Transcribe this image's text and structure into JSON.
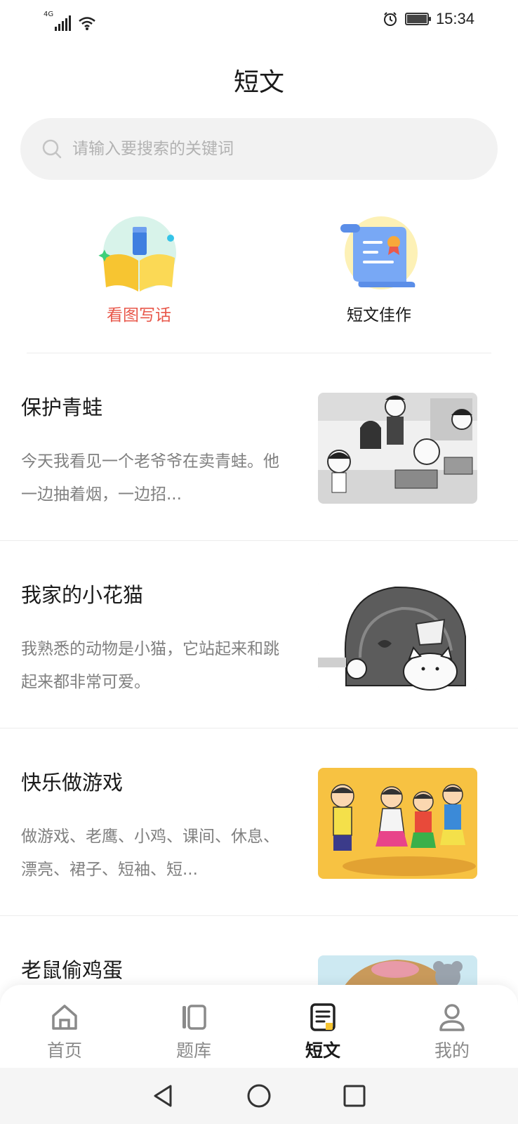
{
  "status_bar": {
    "network": "4G",
    "time": "15:34",
    "battery_level": 0.92
  },
  "page": {
    "title": "短文"
  },
  "search": {
    "placeholder": "请输入要搜索的关键词"
  },
  "categories": [
    {
      "label": "看图写话",
      "icon": "open-book-pencil-icon",
      "color": "#e8574a"
    },
    {
      "label": "短文佳作",
      "icon": "scroll-certificate-icon",
      "color": "#1a1a1a"
    }
  ],
  "articles": [
    {
      "title": "保护青蛙",
      "summary": "今天我看见一个老爷爷在卖青蛙。他一边抽着烟，一边招...",
      "thumbnail": "black-white-cartoon-people-selling-frogs"
    },
    {
      "title": "我家的小花猫",
      "summary": "我熟悉的动物是小猫，它站起来和跳起来都非常可爱。",
      "thumbnail": "black-white-cartoon-cat-by-armchair"
    },
    {
      "title": "快乐做游戏",
      "summary": "做游戏、老鹰、小鸡、课间、休息、漂亮、裙子、短袖、短...",
      "thumbnail": "color-cartoon-children-playing-game"
    },
    {
      "title": "老鼠偷鸡蛋",
      "summary": "",
      "thumbnail": "color-cartoon-mice-egg"
    }
  ],
  "bottom_nav": [
    {
      "label": "首页",
      "icon": "home-icon",
      "active": false
    },
    {
      "label": "题库",
      "icon": "question-bank-icon",
      "active": false
    },
    {
      "label": "短文",
      "icon": "document-icon",
      "active": true
    },
    {
      "label": "我的",
      "icon": "person-icon",
      "active": false
    }
  ],
  "colors": {
    "accent": "#e8574a",
    "nav_active": "#1a1a1a",
    "nav_inactive": "#8a8a8a",
    "highlight_yellow": "#f7c531"
  }
}
